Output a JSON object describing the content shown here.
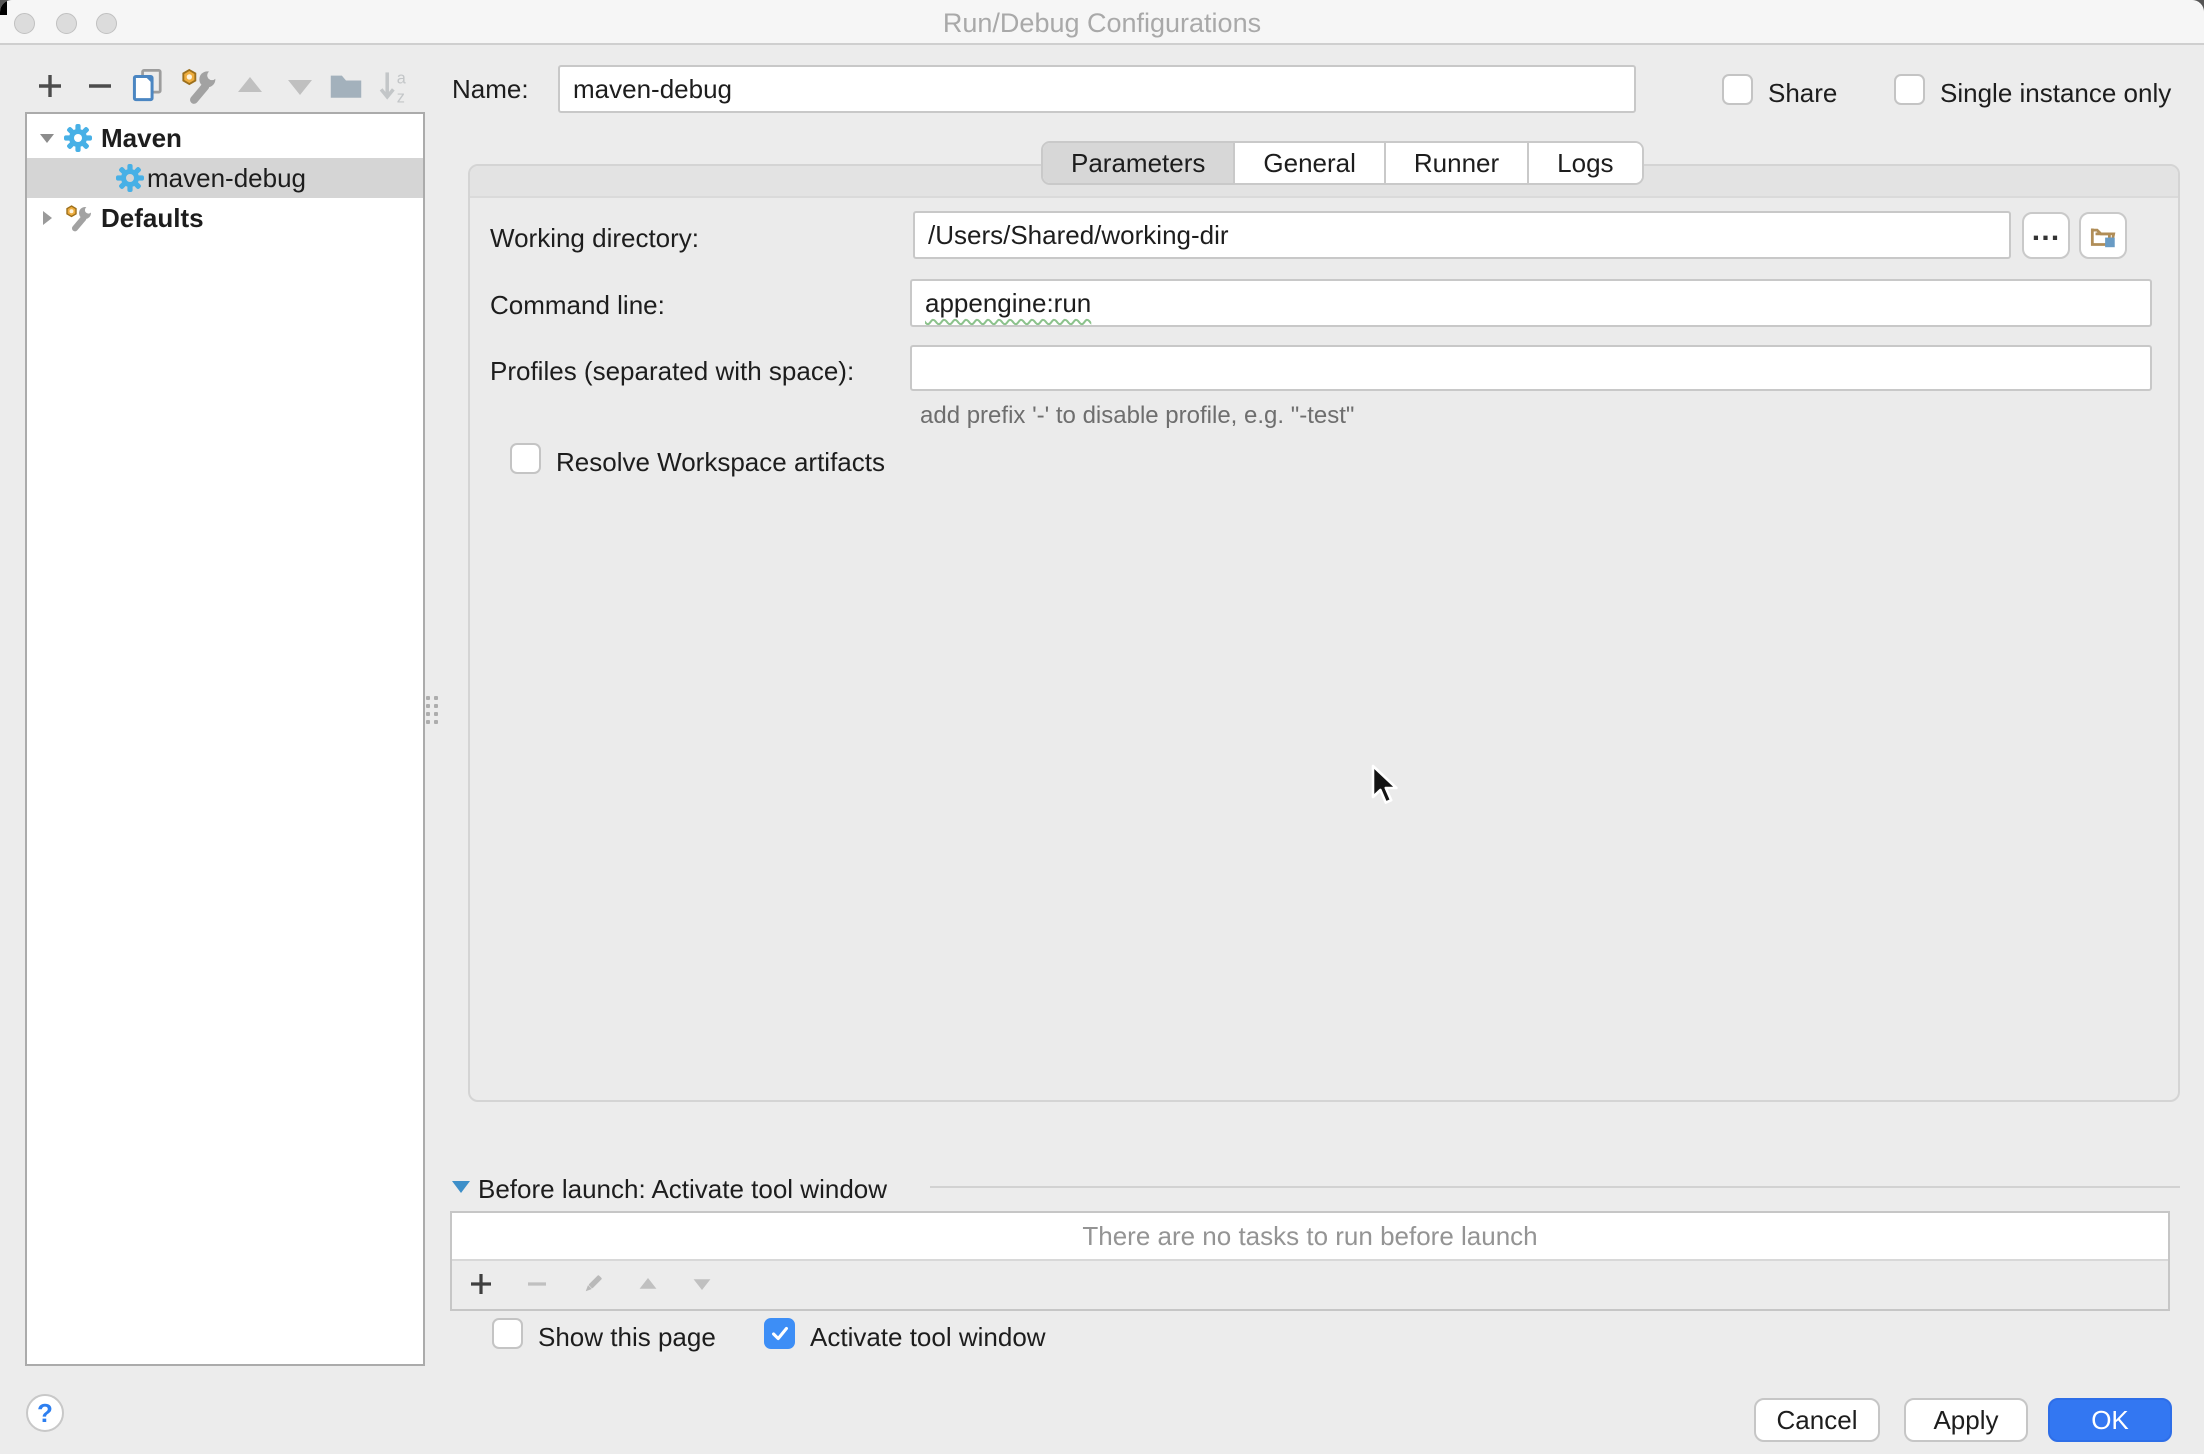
{
  "window": {
    "title": "Run/Debug Configurations"
  },
  "name_field": {
    "label": "Name:",
    "value": "maven-debug"
  },
  "top_options": {
    "share": "Share",
    "single_instance": "Single instance only"
  },
  "tabs": [
    {
      "label": "Parameters",
      "selected": true
    },
    {
      "label": "General",
      "selected": false
    },
    {
      "label": "Runner",
      "selected": false
    },
    {
      "label": "Logs",
      "selected": false
    }
  ],
  "tree": {
    "items": [
      {
        "label": "Maven",
        "type": "group",
        "expanded": true
      },
      {
        "label": "maven-debug",
        "type": "configuration",
        "selected": true
      },
      {
        "label": "Defaults",
        "type": "group",
        "expanded": false
      }
    ]
  },
  "form": {
    "working_directory": {
      "label": "Working directory:",
      "value": "/Users/Shared/working-dir",
      "browse": "…"
    },
    "command_line": {
      "label": "Command line:",
      "value": "appengine:run"
    },
    "profiles": {
      "label": "Profiles (separated with space):",
      "value": "",
      "hint": "add prefix '-' to disable profile, e.g. \"-test\""
    },
    "resolve_workspace": "Resolve Workspace artifacts"
  },
  "before_launch": {
    "title": "Before launch: Activate tool window",
    "empty_text": "There are no tasks to run before launch",
    "show_this_page": "Show this page",
    "activate_tool_window": "Activate tool window",
    "activate_checked": true
  },
  "footer": {
    "cancel": "Cancel",
    "apply": "Apply",
    "ok": "OK",
    "help": "?"
  },
  "icons": {
    "toolbar": [
      "add",
      "remove",
      "copy",
      "edit-defaults",
      "move-up",
      "move-down",
      "new-folder",
      "sort-alphabetically"
    ],
    "task_toolbar": [
      "add",
      "remove",
      "edit",
      "move-up",
      "move-down"
    ],
    "working_directory": [
      "browse-ellipsis",
      "choose-folder"
    ]
  },
  "colors": {
    "ok_button": "#3377f2",
    "checkbox_checked": "#3d8ef6",
    "maven_gear": "#47b0e6",
    "selected_row": "#d5d5d5",
    "before_launch_arrow": "#3d8fc9"
  }
}
